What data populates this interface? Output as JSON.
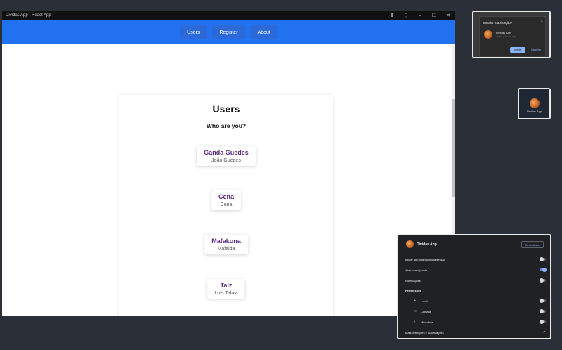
{
  "window": {
    "title": "Dividas App - React App",
    "controls": [
      "puzzle-icon",
      "menu-dots-icon",
      "minimize-icon",
      "maximize-icon",
      "close-icon"
    ]
  },
  "navbar": {
    "items": [
      {
        "label": "Users"
      },
      {
        "label": "Register"
      },
      {
        "label": "About"
      }
    ],
    "color": "#2271f1"
  },
  "main": {
    "title": "Users",
    "subtitle": "Who are you?",
    "users": [
      {
        "name": "Ganda Guedes",
        "real_name": "João Guedes"
      },
      {
        "name": "Cena",
        "real_name": "Cena"
      },
      {
        "name": "Mafakona",
        "real_name": "Mafalda"
      },
      {
        "name": "Talz",
        "real_name": "Luís Talaia"
      }
    ]
  },
  "install_dialog": {
    "title": "Instalar a aplicação?",
    "app_name": "Dividas App",
    "url": "dividas-pwa.web.app",
    "install_label": "Instalar",
    "cancel_label": "Cancelar"
  },
  "shortcut": {
    "label": "Dividas App"
  },
  "settings": {
    "app_name": "Dividas App",
    "uninstall_label": "Desinstalar",
    "rows": [
      {
        "label": "Iniciar app quando inicia sessão",
        "on": false
      },
      {
        "label": "Abrir como janela",
        "on": true
      },
      {
        "label": "Notificações",
        "on": false
      }
    ],
    "permissions_title": "Permissões",
    "permissions": [
      {
        "icon": "location-pin-icon",
        "label": "Local",
        "on": false
      },
      {
        "icon": "camera-icon",
        "label": "Câmara",
        "on": false
      },
      {
        "icon": "microphone-icon",
        "label": "Microfone",
        "on": false
      }
    ],
    "more_label": "Mais definições e autorizações"
  }
}
